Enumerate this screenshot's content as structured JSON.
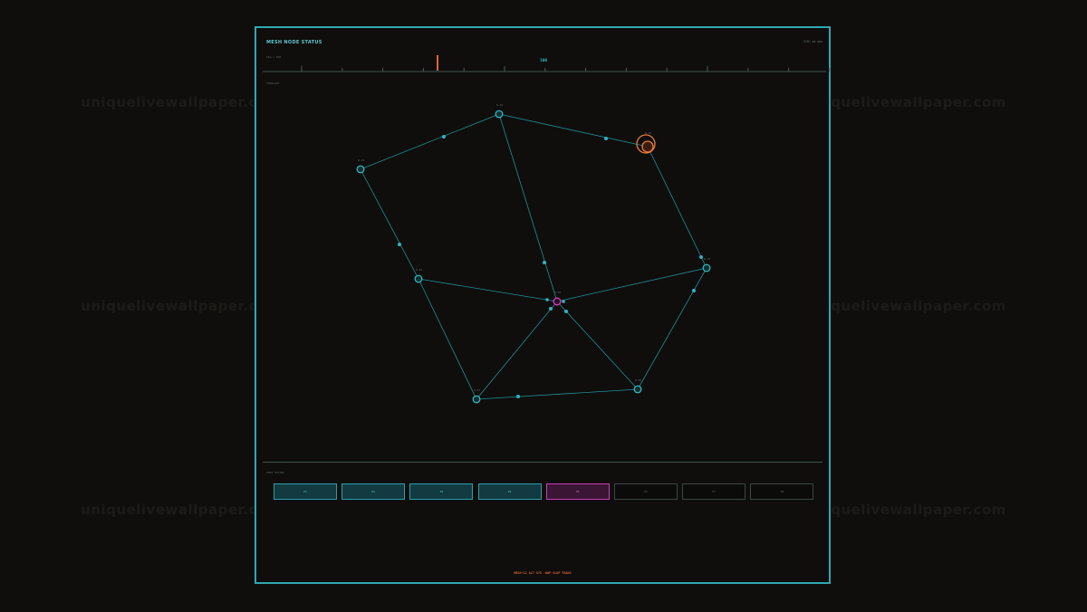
{
  "watermark": "uniquelivewallpaper.com",
  "panel": {
    "title": "MESH NODE STATUS",
    "top_right": "SYNC ▮▮ ▮▮▮",
    "ruler_caption": "SIG / INT",
    "ruler_value": "100",
    "section_top": "TOPOLOGY",
    "section_ports": "PORT STATUS"
  },
  "nodes": [
    {
      "id": "n1",
      "label": "N-01",
      "kind": "normal"
    },
    {
      "id": "n2",
      "label": "N-02",
      "kind": "normal"
    },
    {
      "id": "n3",
      "label": "N-03",
      "kind": "warning"
    },
    {
      "id": "n4",
      "label": "N-04",
      "kind": "normal"
    },
    {
      "id": "n5",
      "label": "N-05",
      "kind": "normal"
    },
    {
      "id": "n6",
      "label": "N-06",
      "kind": "alert"
    },
    {
      "id": "n7",
      "label": "N-07",
      "kind": "normal"
    },
    {
      "id": "n8",
      "label": "N-08",
      "kind": "normal"
    }
  ],
  "ports": [
    {
      "label": "P1",
      "state": "active"
    },
    {
      "label": "P2",
      "state": "active"
    },
    {
      "label": "P3",
      "state": "active"
    },
    {
      "label": "P4",
      "state": "active"
    },
    {
      "label": "P5",
      "state": "alert"
    },
    {
      "label": "P6",
      "state": "idle"
    },
    {
      "label": "P7",
      "state": "idle"
    },
    {
      "label": "P8",
      "state": "idle"
    }
  ],
  "footer": "MESH-12 ALT·SYS ·NWF·SLNF·TRANS",
  "colors": {
    "frame": "#2fa8b3",
    "link": "#1f8e99",
    "warning": "#f07b3c",
    "alert": "#d43bb8",
    "indicator": "#e2672f"
  }
}
